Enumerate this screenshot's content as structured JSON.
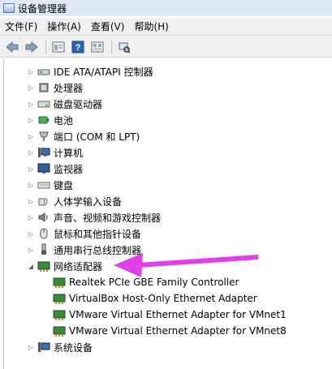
{
  "window": {
    "title": "设备管理器"
  },
  "menu": [
    "文件(F)",
    "操作(A)",
    "查看(V)",
    "帮助(H)"
  ],
  "toolbar": {
    "icons": [
      "back-icon",
      "forward-icon",
      "properties-icon",
      "help-icon",
      "view-icon",
      "scan-hardware-icon"
    ]
  },
  "tree": {
    "categories": [
      {
        "label": "IDE ATA/ATAPI 控制器",
        "icon": "ide-controller-icon"
      },
      {
        "label": "处理器",
        "icon": "processor-icon"
      },
      {
        "label": "磁盘驱动器",
        "icon": "disk-drive-icon"
      },
      {
        "label": "电池",
        "icon": "battery-icon"
      },
      {
        "label": "端口 (COM 和 LPT)",
        "icon": "port-icon"
      },
      {
        "label": "计算机",
        "icon": "computer-icon"
      },
      {
        "label": "监视器",
        "icon": "monitor-icon"
      },
      {
        "label": "键盘",
        "icon": "keyboard-icon"
      },
      {
        "label": "人体学输入设备",
        "icon": "hid-icon"
      },
      {
        "label": "声音、视频和游戏控制器",
        "icon": "sound-icon"
      },
      {
        "label": "鼠标和其他指针设备",
        "icon": "mouse-icon"
      },
      {
        "label": "通用串行总线控制器",
        "icon": "usb-icon"
      }
    ],
    "network": {
      "label": "网络适配器",
      "icon": "network-adapter-icon",
      "children": [
        "Realtek PCIe GBE Family Controller",
        "VirtualBox Host-Only Ethernet Adapter",
        "VMware Virtual Ethernet Adapter for VMnet1",
        "VMware Virtual Ethernet Adapter for VMnet8"
      ]
    },
    "last": {
      "label": "系统设备",
      "icon": "system-devices-icon"
    }
  },
  "colors": {
    "arrow": "#e040e8",
    "accent": "#3a6fb0"
  }
}
